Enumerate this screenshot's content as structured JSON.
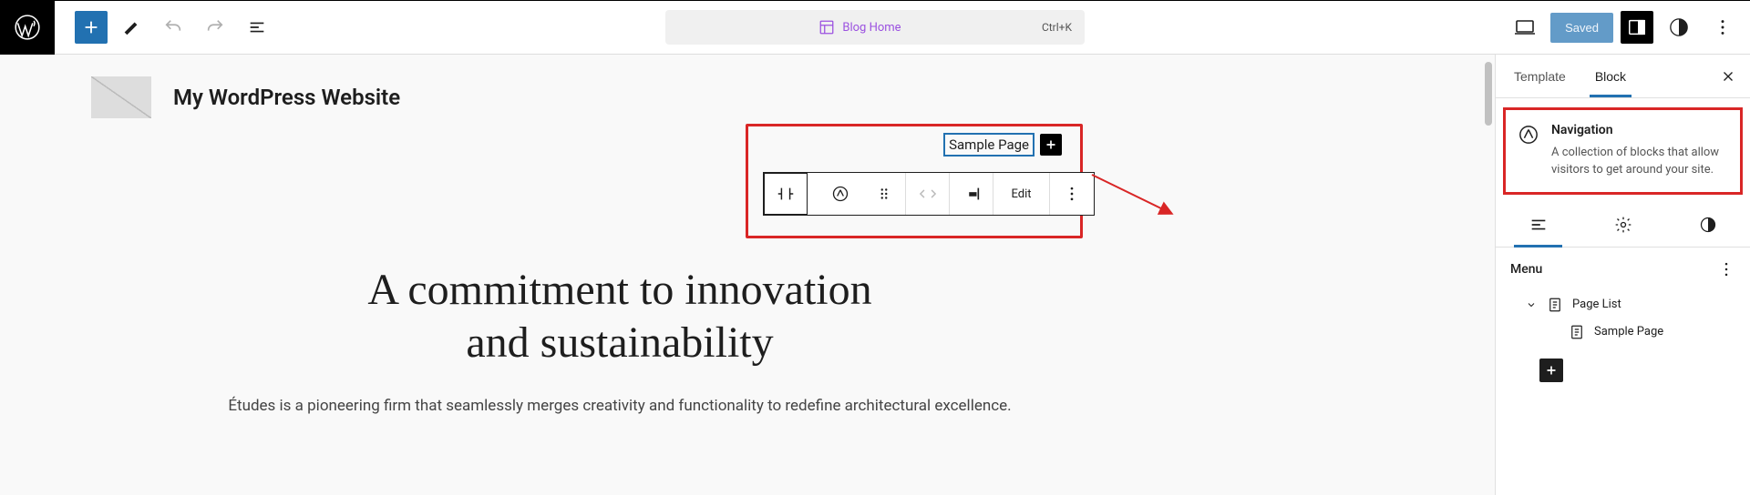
{
  "topbar": {
    "document_title": "Blog Home",
    "shortcut": "Ctrl+K",
    "saved_label": "Saved"
  },
  "site": {
    "title": "My WordPress Website"
  },
  "nav_block": {
    "link_label": "Sample Page",
    "toolbar_edit": "Edit"
  },
  "hero": {
    "heading_line1": "A commitment to innovation",
    "heading_line2": "and sustainability",
    "paragraph": "Études is a pioneering firm that seamlessly merges creativity and functionality to redefine architectural excellence."
  },
  "sidebar": {
    "tab_template": "Template",
    "tab_block": "Block",
    "nav_card": {
      "title": "Navigation",
      "desc": "A collection of blocks that allow visitors to get around your site."
    },
    "menu_heading": "Menu",
    "tree": {
      "page_list": "Page List",
      "sample_page": "Sample Page"
    }
  }
}
